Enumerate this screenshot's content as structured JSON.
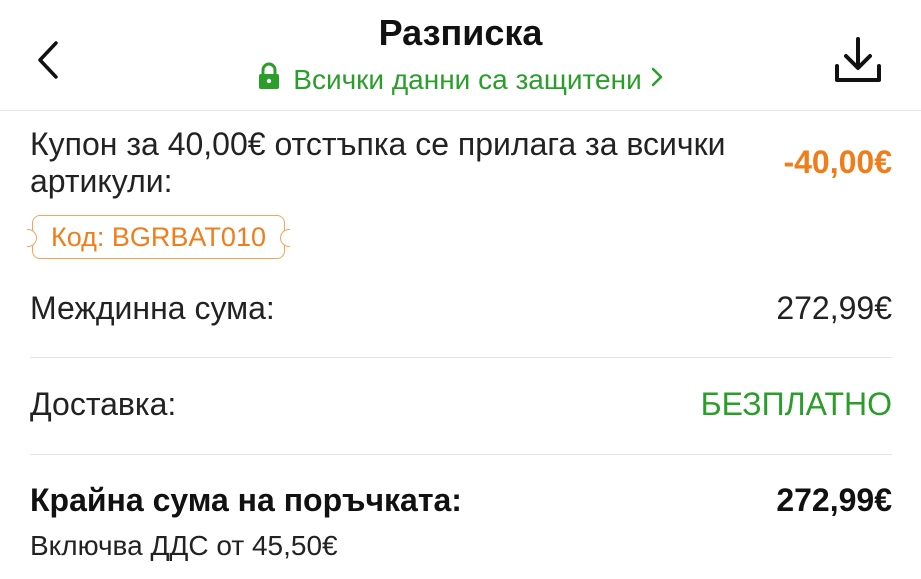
{
  "header": {
    "title": "Разписка",
    "secure_text": "Всички данни са защитени",
    "icons": [
      "back-arrow-icon",
      "lock-icon",
      "chevron-right-icon",
      "download-icon"
    ]
  },
  "coupon": {
    "text": "Купон за 40,00€ отстъпка се прилага за всички артикули:",
    "amount": "-40,00€",
    "code": "Код: BGRBAT010"
  },
  "subtotal": {
    "label": "Междинна сума:",
    "value": "272,99€"
  },
  "shipping": {
    "label": "Доставка:",
    "value": "БЕЗПЛАТНО"
  },
  "total": {
    "label": "Крайна сума на поръчката:",
    "value": "272,99€",
    "vat_note": "Включва ДДС от 45,50€"
  },
  "colors": {
    "accent_green": "#2a9d2a",
    "accent_orange": "#f07d1a",
    "text": "#222222",
    "divider": "#e6e6e6"
  }
}
